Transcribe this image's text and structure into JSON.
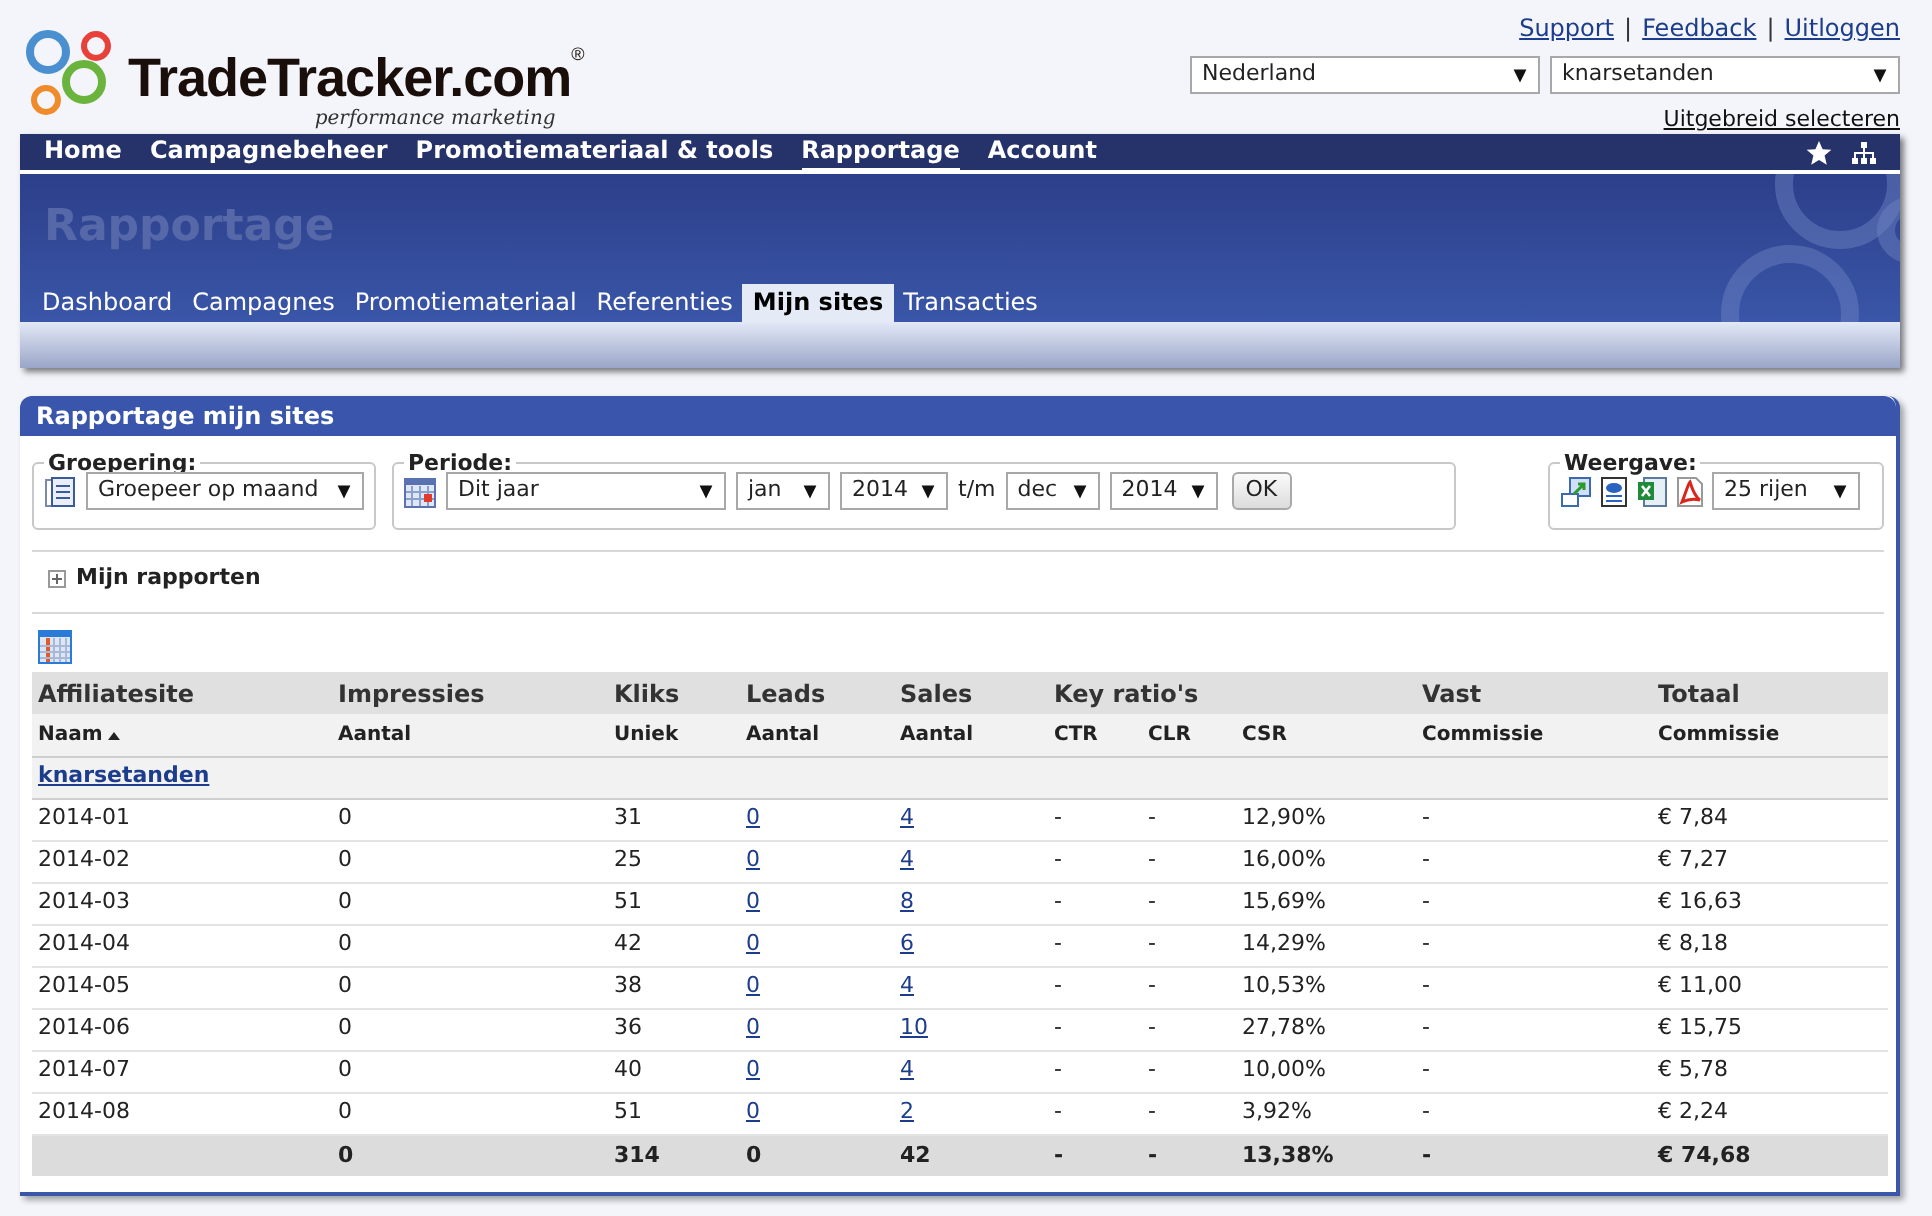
{
  "logo": {
    "name": "TradeTracker.com",
    "mark": "®",
    "tagline": "performance marketing"
  },
  "top_links": [
    "Support",
    "Feedback",
    "Uitloggen"
  ],
  "top_separator": "|",
  "country_select": {
    "value": "Nederland"
  },
  "site_select": {
    "value": "knarsetanden"
  },
  "advanced_link": "Uitgebreid selecteren",
  "main_nav": [
    {
      "label": "Home",
      "selected": false
    },
    {
      "label": "Campagnebeheer",
      "selected": false
    },
    {
      "label": "Promotiemateriaal & tools",
      "selected": false
    },
    {
      "label": "Rapportage",
      "selected": true
    },
    {
      "label": "Account",
      "selected": false
    }
  ],
  "banner_title": "Rapportage",
  "sub_tabs": [
    {
      "label": "Dashboard",
      "selected": false
    },
    {
      "label": "Campagnes",
      "selected": false
    },
    {
      "label": "Promotiemateriaal",
      "selected": false
    },
    {
      "label": "Referenties",
      "selected": false
    },
    {
      "label": "Mijn sites",
      "selected": true
    },
    {
      "label": "Transacties",
      "selected": false
    }
  ],
  "panel": {
    "title": "Rapportage mijn sites",
    "grouping": {
      "legend": "Groepering:",
      "value": "Groepeer op maand"
    },
    "period": {
      "legend": "Periode:",
      "preset": "Dit jaar",
      "from_month": "jan",
      "from_year": "2014",
      "to_label": "t/m",
      "to_month": "dec",
      "to_year": "2014",
      "ok": "OK"
    },
    "view": {
      "legend": "Weergave:",
      "rows": "25 rijen"
    },
    "my_reports": {
      "label": "Mijn rapporten",
      "expanded": false
    },
    "table": {
      "groups": [
        {
          "label": "Affiliatesite",
          "columns": [
            {
              "label": "Naam",
              "sorted": true,
              "kind": "text"
            }
          ]
        },
        {
          "label": "Impressies",
          "columns": [
            {
              "label": "Aantal",
              "sorted": false,
              "kind": "text"
            }
          ]
        },
        {
          "label": "Kliks",
          "columns": [
            {
              "label": "Uniek",
              "sorted": false,
              "kind": "text"
            }
          ]
        },
        {
          "label": "Leads",
          "columns": [
            {
              "label": "Aantal",
              "sorted": false,
              "kind": "link"
            }
          ]
        },
        {
          "label": "Sales",
          "columns": [
            {
              "label": "Aantal",
              "sorted": false,
              "kind": "link"
            }
          ]
        },
        {
          "label": "Key ratio's",
          "columns": [
            {
              "label": "CTR",
              "sorted": false,
              "kind": "text"
            },
            {
              "label": "CLR",
              "sorted": false,
              "kind": "text"
            },
            {
              "label": "CSR",
              "sorted": false,
              "kind": "text"
            }
          ]
        },
        {
          "label": "Vast",
          "columns": [
            {
              "label": "Commissie",
              "sorted": false,
              "kind": "text"
            }
          ]
        },
        {
          "label": "Totaal",
          "columns": [
            {
              "label": "Commissie",
              "sorted": false,
              "kind": "text"
            }
          ]
        }
      ],
      "site_group": "knarsetanden",
      "rows": [
        [
          "2014-01",
          "0",
          "31",
          "0",
          "4",
          "-",
          "-",
          "12,90%",
          "-",
          "€ 7,84"
        ],
        [
          "2014-02",
          "0",
          "25",
          "0",
          "4",
          "-",
          "-",
          "16,00%",
          "-",
          "€ 7,27"
        ],
        [
          "2014-03",
          "0",
          "51",
          "0",
          "8",
          "-",
          "-",
          "15,69%",
          "-",
          "€ 16,63"
        ],
        [
          "2014-04",
          "0",
          "42",
          "0",
          "6",
          "-",
          "-",
          "14,29%",
          "-",
          "€ 8,18"
        ],
        [
          "2014-05",
          "0",
          "38",
          "0",
          "4",
          "-",
          "-",
          "10,53%",
          "-",
          "€ 11,00"
        ],
        [
          "2014-06",
          "0",
          "36",
          "0",
          "10",
          "-",
          "-",
          "27,78%",
          "-",
          "€ 15,75"
        ],
        [
          "2014-07",
          "0",
          "40",
          "0",
          "4",
          "-",
          "-",
          "10,00%",
          "-",
          "€ 5,78"
        ],
        [
          "2014-08",
          "0",
          "51",
          "0",
          "2",
          "-",
          "-",
          "3,92%",
          "-",
          "€ 2,24"
        ]
      ],
      "total": [
        "0",
        "314",
        "0",
        "42",
        "-",
        "-",
        "13,38%",
        "-",
        "€ 74,68"
      ]
    }
  }
}
